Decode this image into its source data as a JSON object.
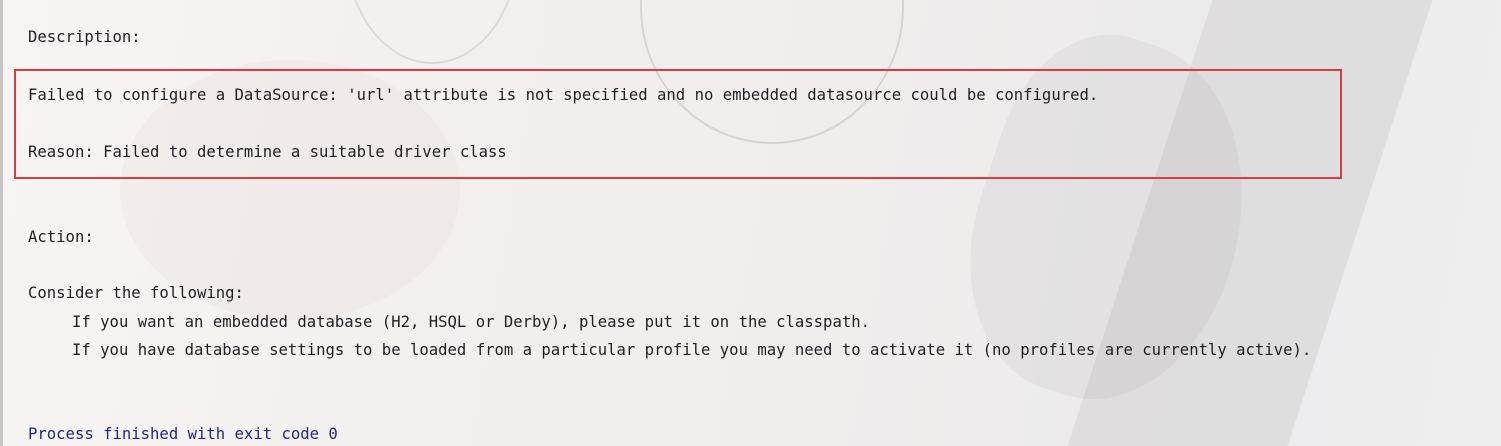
{
  "console": {
    "description_label": "Description:",
    "error_message": "Failed to configure a DataSource: 'url' attribute is not specified and no embedded datasource could be configured.",
    "reason": "Reason: Failed to determine a suitable driver class",
    "action_label": "Action:",
    "consider_label": "Consider the following:",
    "suggestion_1": "If you want an embedded database (H2, HSQL or Derby), please put it on the classpath.",
    "suggestion_2": "If you have database settings to be loaded from a particular profile you may need to activate it (no profiles are currently active).",
    "exit_message": "Process finished with exit code 0"
  },
  "colors": {
    "text": "#1f1f24",
    "exit_text": "#1c2a8a",
    "highlight_border": "#e0393e"
  }
}
